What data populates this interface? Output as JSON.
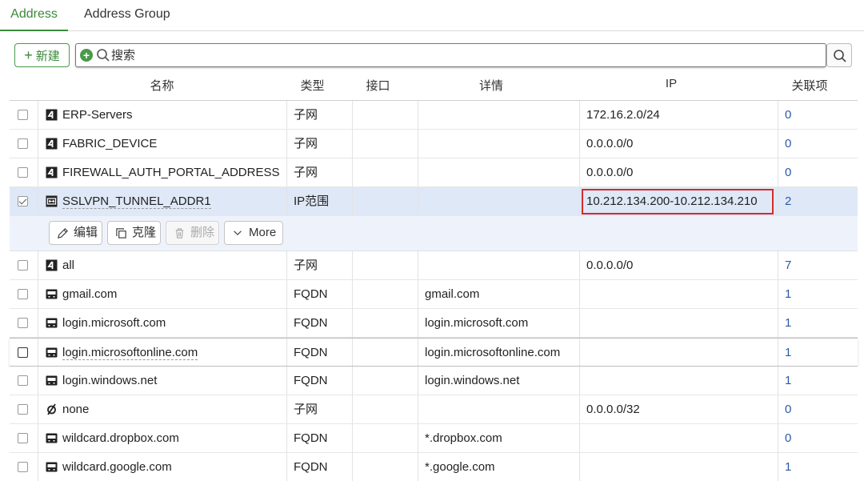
{
  "tabs": [
    {
      "label": "Address",
      "active": true
    },
    {
      "label": "Address Group",
      "active": false
    }
  ],
  "toolbar": {
    "new_label": "新建",
    "search_placeholder": "搜索"
  },
  "columns": [
    "名称",
    "类型",
    "接口",
    "详情",
    "IP",
    "关联项"
  ],
  "rows": [
    {
      "name": "ERP-Servers",
      "icon": "subnet-icon",
      "type": "子网",
      "interface": "",
      "details": "",
      "ip": "172.16.2.0/24",
      "refs": "0",
      "checked": false
    },
    {
      "name": "FABRIC_DEVICE",
      "icon": "subnet-icon",
      "type": "子网",
      "interface": "",
      "details": "",
      "ip": "0.0.0.0/0",
      "refs": "0",
      "checked": false
    },
    {
      "name": "FIREWALL_AUTH_PORTAL_ADDRESS",
      "icon": "subnet-icon",
      "type": "子网",
      "interface": "",
      "details": "",
      "ip": "0.0.0.0/0",
      "refs": "0",
      "checked": false
    },
    {
      "name": "SSLVPN_TUNNEL_ADDR1",
      "icon": "ip-range-icon",
      "type": "IP范围",
      "interface": "",
      "details": "",
      "ip": "10.212.134.200-10.212.134.210",
      "refs": "2",
      "checked": true
    },
    {
      "name": "all",
      "icon": "subnet-icon",
      "type": "子网",
      "interface": "",
      "details": "",
      "ip": "0.0.0.0/0",
      "refs": "7",
      "checked": false
    },
    {
      "name": "gmail.com",
      "icon": "fqdn-icon",
      "type": "FQDN",
      "interface": "",
      "details": "gmail.com",
      "ip": "",
      "refs": "1",
      "checked": false
    },
    {
      "name": "login.microsoft.com",
      "icon": "fqdn-icon",
      "type": "FQDN",
      "interface": "",
      "details": "login.microsoft.com",
      "ip": "",
      "refs": "1",
      "checked": false
    },
    {
      "name": "login.microsoftonline.com",
      "icon": "fqdn-icon",
      "type": "FQDN",
      "interface": "",
      "details": "login.microsoftonline.com",
      "ip": "",
      "refs": "1",
      "checked": false
    },
    {
      "name": "login.windows.net",
      "icon": "fqdn-icon",
      "type": "FQDN",
      "interface": "",
      "details": "login.windows.net",
      "ip": "",
      "refs": "1",
      "checked": false
    },
    {
      "name": "none",
      "icon": "none-icon",
      "type": "子网",
      "interface": "",
      "details": "",
      "ip": "0.0.0.0/32",
      "refs": "0",
      "checked": false
    },
    {
      "name": "wildcard.dropbox.com",
      "icon": "fqdn-icon",
      "type": "FQDN",
      "interface": "",
      "details": "*.dropbox.com",
      "ip": "",
      "refs": "0",
      "checked": false
    },
    {
      "name": "wildcard.google.com",
      "icon": "fqdn-icon",
      "type": "FQDN",
      "interface": "",
      "details": "*.google.com",
      "ip": "",
      "refs": "1",
      "checked": false
    }
  ],
  "row_actions": {
    "edit_label": "编辑",
    "clone_label": "克隆",
    "delete_label": "删除",
    "more_label": "More"
  },
  "colors": {
    "accent_green": "#3a8a3a",
    "link_blue": "#2a5aa8",
    "selected_row": "#dfe8f7",
    "highlight_red": "#d62b2b"
  }
}
